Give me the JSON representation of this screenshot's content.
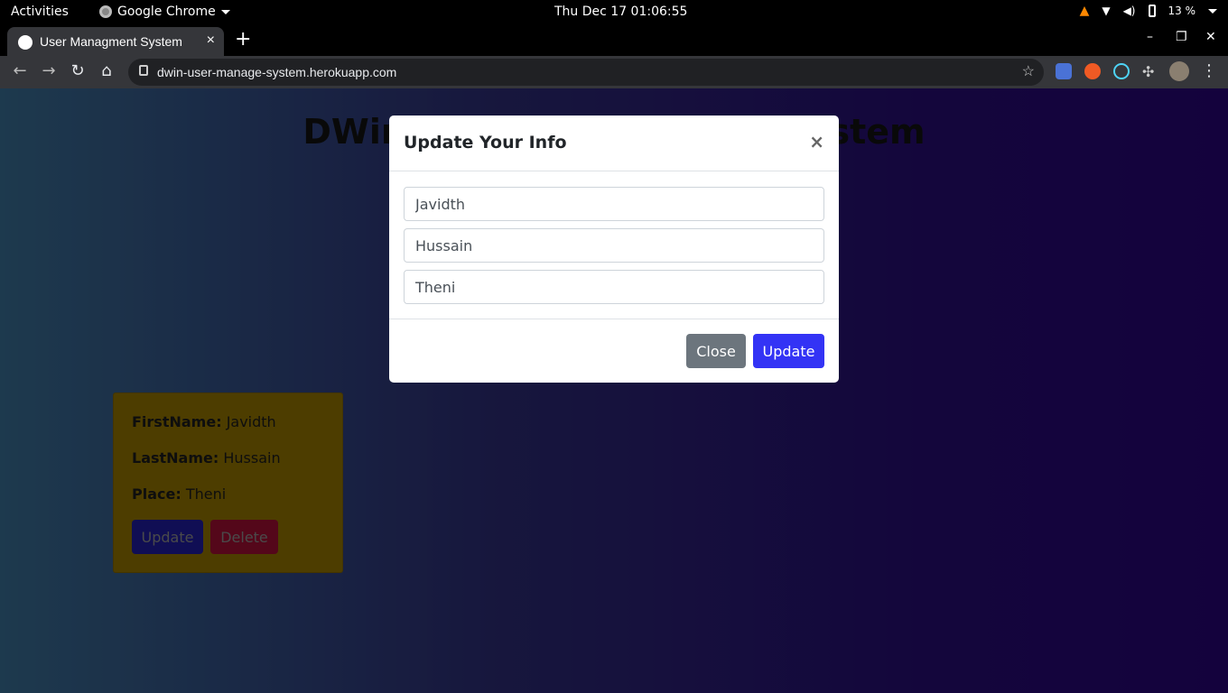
{
  "os_bar": {
    "activities": "Activities",
    "app_name": "Google Chrome",
    "clock": "Thu Dec 17  01:06:55",
    "battery": "13 %"
  },
  "browser": {
    "tab_title": "User Managment System",
    "tab_close": "×",
    "new_tab": "+",
    "url": "dwin-user-manage-system.herokuapp.com",
    "window_controls": [
      "–",
      "❐",
      "✕"
    ]
  },
  "page": {
    "title": "DWin User Management System",
    "card": {
      "firstname_label": "FirstName:",
      "firstname_value": "Javidth",
      "lastname_label": "LastName:",
      "lastname_value": "Hussain",
      "place_label": "Place:",
      "place_value": "Theni",
      "update_label": "Update",
      "delete_label": "Delete"
    }
  },
  "modal": {
    "title": "Update Your Info",
    "close_x": "×",
    "fields": {
      "firstname": "Javidth",
      "lastname": "Hussain",
      "place": "Theni"
    },
    "close_button": "Close",
    "update_button": "Update"
  },
  "colors": {
    "update_blue": "#3333f5",
    "close_gray": "#6c757d",
    "card_bg": "#8c6f00",
    "delete_red": "#a0102e"
  }
}
